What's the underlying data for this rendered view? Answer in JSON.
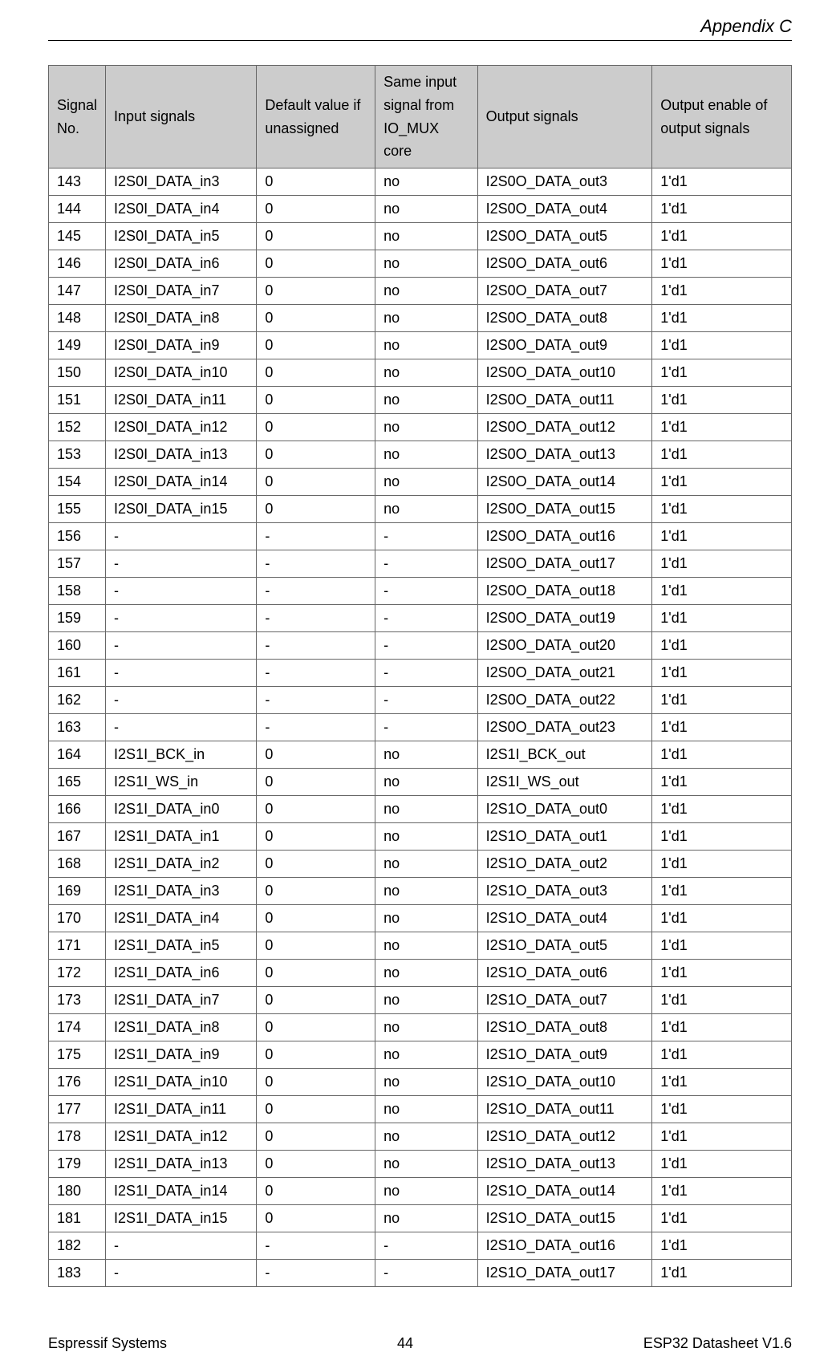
{
  "header": {
    "title": "Appendix C"
  },
  "table": {
    "headers": {
      "signal_no": "Signal No.",
      "input_signals": "Input signals",
      "default_value": "Default value if unassigned",
      "same_input": "Same input signal from IO_MUX core",
      "output_signals": "Output signals",
      "output_enable": "Output enable of output signals"
    },
    "rows": [
      {
        "no": "143",
        "in": "I2S0I_DATA_in3",
        "def": "0",
        "same": "no",
        "out": "I2S0O_DATA_out3",
        "en": "1'd1"
      },
      {
        "no": "144",
        "in": "I2S0I_DATA_in4",
        "def": "0",
        "same": "no",
        "out": "I2S0O_DATA_out4",
        "en": "1'd1"
      },
      {
        "no": "145",
        "in": "I2S0I_DATA_in5",
        "def": "0",
        "same": "no",
        "out": "I2S0O_DATA_out5",
        "en": "1'd1"
      },
      {
        "no": "146",
        "in": "I2S0I_DATA_in6",
        "def": "0",
        "same": "no",
        "out": "I2S0O_DATA_out6",
        "en": "1'd1"
      },
      {
        "no": "147",
        "in": "I2S0I_DATA_in7",
        "def": "0",
        "same": "no",
        "out": "I2S0O_DATA_out7",
        "en": "1'd1"
      },
      {
        "no": "148",
        "in": "I2S0I_DATA_in8",
        "def": "0",
        "same": "no",
        "out": "I2S0O_DATA_out8",
        "en": "1'd1"
      },
      {
        "no": "149",
        "in": "I2S0I_DATA_in9",
        "def": "0",
        "same": "no",
        "out": "I2S0O_DATA_out9",
        "en": "1'd1"
      },
      {
        "no": "150",
        "in": "I2S0I_DATA_in10",
        "def": "0",
        "same": "no",
        "out": "I2S0O_DATA_out10",
        "en": "1'd1"
      },
      {
        "no": "151",
        "in": "I2S0I_DATA_in11",
        "def": "0",
        "same": "no",
        "out": "I2S0O_DATA_out11",
        "en": "1'd1"
      },
      {
        "no": "152",
        "in": "I2S0I_DATA_in12",
        "def": "0",
        "same": "no",
        "out": "I2S0O_DATA_out12",
        "en": "1'd1"
      },
      {
        "no": "153",
        "in": "I2S0I_DATA_in13",
        "def": "0",
        "same": "no",
        "out": "I2S0O_DATA_out13",
        "en": "1'd1"
      },
      {
        "no": "154",
        "in": "I2S0I_DATA_in14",
        "def": "0",
        "same": "no",
        "out": "I2S0O_DATA_out14",
        "en": "1'd1"
      },
      {
        "no": "155",
        "in": "I2S0I_DATA_in15",
        "def": "0",
        "same": "no",
        "out": "I2S0O_DATA_out15",
        "en": "1'd1"
      },
      {
        "no": "156",
        "in": "-",
        "def": "-",
        "same": "-",
        "out": "I2S0O_DATA_out16",
        "en": "1'd1"
      },
      {
        "no": "157",
        "in": "-",
        "def": "-",
        "same": "-",
        "out": "I2S0O_DATA_out17",
        "en": "1'd1"
      },
      {
        "no": "158",
        "in": "-",
        "def": "-",
        "same": "-",
        "out": "I2S0O_DATA_out18",
        "en": "1'd1"
      },
      {
        "no": "159",
        "in": "-",
        "def": "-",
        "same": "-",
        "out": "I2S0O_DATA_out19",
        "en": "1'd1"
      },
      {
        "no": "160",
        "in": "-",
        "def": "-",
        "same": "-",
        "out": "I2S0O_DATA_out20",
        "en": "1'd1"
      },
      {
        "no": "161",
        "in": "-",
        "def": "-",
        "same": "-",
        "out": "I2S0O_DATA_out21",
        "en": "1'd1"
      },
      {
        "no": "162",
        "in": "-",
        "def": "-",
        "same": "-",
        "out": "I2S0O_DATA_out22",
        "en": "1'd1"
      },
      {
        "no": "163",
        "in": "-",
        "def": "-",
        "same": "-",
        "out": "I2S0O_DATA_out23",
        "en": "1'd1"
      },
      {
        "no": "164",
        "in": "I2S1I_BCK_in",
        "def": "0",
        "same": "no",
        "out": "I2S1I_BCK_out",
        "en": "1'd1"
      },
      {
        "no": "165",
        "in": "I2S1I_WS_in",
        "def": "0",
        "same": "no",
        "out": "I2S1I_WS_out",
        "en": "1'd1"
      },
      {
        "no": "166",
        "in": "I2S1I_DATA_in0",
        "def": "0",
        "same": "no",
        "out": "I2S1O_DATA_out0",
        "en": "1'd1"
      },
      {
        "no": "167",
        "in": "I2S1I_DATA_in1",
        "def": "0",
        "same": "no",
        "out": "I2S1O_DATA_out1",
        "en": "1'd1"
      },
      {
        "no": "168",
        "in": "I2S1I_DATA_in2",
        "def": "0",
        "same": "no",
        "out": "I2S1O_DATA_out2",
        "en": "1'd1"
      },
      {
        "no": "169",
        "in": "I2S1I_DATA_in3",
        "def": "0",
        "same": "no",
        "out": "I2S1O_DATA_out3",
        "en": "1'd1"
      },
      {
        "no": "170",
        "in": "I2S1I_DATA_in4",
        "def": "0",
        "same": "no",
        "out": "I2S1O_DATA_out4",
        "en": "1'd1"
      },
      {
        "no": "171",
        "in": "I2S1I_DATA_in5",
        "def": "0",
        "same": "no",
        "out": "I2S1O_DATA_out5",
        "en": "1'd1"
      },
      {
        "no": "172",
        "in": "I2S1I_DATA_in6",
        "def": "0",
        "same": "no",
        "out": "I2S1O_DATA_out6",
        "en": "1'd1"
      },
      {
        "no": "173",
        "in": "I2S1I_DATA_in7",
        "def": "0",
        "same": "no",
        "out": "I2S1O_DATA_out7",
        "en": "1'd1"
      },
      {
        "no": "174",
        "in": "I2S1I_DATA_in8",
        "def": "0",
        "same": "no",
        "out": "I2S1O_DATA_out8",
        "en": "1'd1"
      },
      {
        "no": "175",
        "in": "I2S1I_DATA_in9",
        "def": "0",
        "same": "no",
        "out": "I2S1O_DATA_out9",
        "en": "1'd1"
      },
      {
        "no": "176",
        "in": "I2S1I_DATA_in10",
        "def": "0",
        "same": "no",
        "out": "I2S1O_DATA_out10",
        "en": "1'd1"
      },
      {
        "no": "177",
        "in": "I2S1I_DATA_in11",
        "def": "0",
        "same": "no",
        "out": "I2S1O_DATA_out11",
        "en": "1'd1"
      },
      {
        "no": "178",
        "in": "I2S1I_DATA_in12",
        "def": "0",
        "same": "no",
        "out": "I2S1O_DATA_out12",
        "en": "1'd1"
      },
      {
        "no": "179",
        "in": "I2S1I_DATA_in13",
        "def": "0",
        "same": "no",
        "out": "I2S1O_DATA_out13",
        "en": "1'd1"
      },
      {
        "no": "180",
        "in": "I2S1I_DATA_in14",
        "def": "0",
        "same": "no",
        "out": "I2S1O_DATA_out14",
        "en": "1'd1"
      },
      {
        "no": "181",
        "in": "I2S1I_DATA_in15",
        "def": "0",
        "same": "no",
        "out": "I2S1O_DATA_out15",
        "en": "1'd1"
      },
      {
        "no": "182",
        "in": "-",
        "def": "-",
        "same": "-",
        "out": "I2S1O_DATA_out16",
        "en": "1'd1"
      },
      {
        "no": "183",
        "in": "-",
        "def": "-",
        "same": "-",
        "out": "I2S1O_DATA_out17",
        "en": "1'd1"
      }
    ]
  },
  "footer": {
    "left": "Espressif Systems",
    "center": "44",
    "right": "ESP32 Datasheet V1.6"
  }
}
